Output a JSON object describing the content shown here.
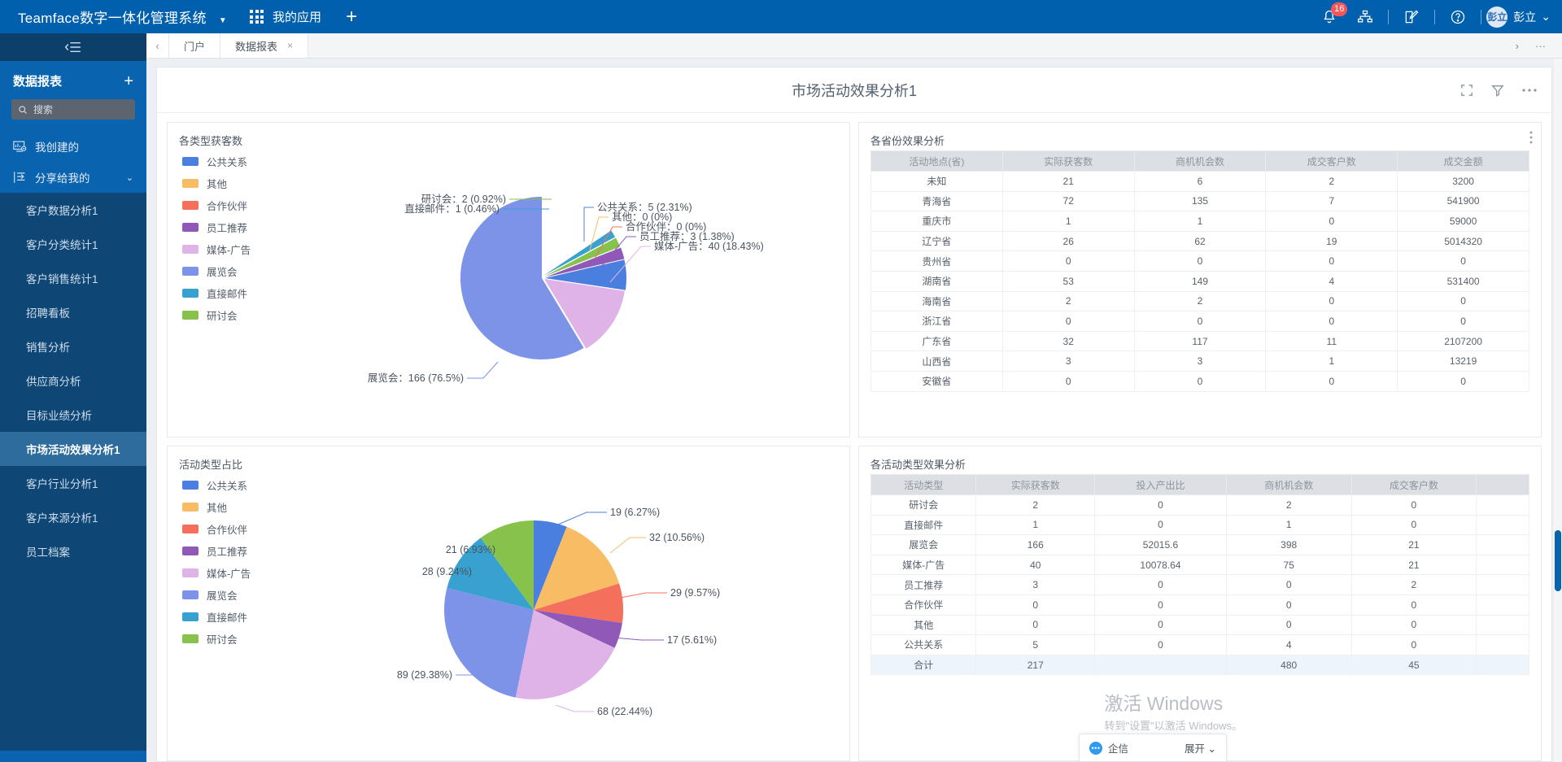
{
  "topbar": {
    "brand": "Teamface数字一体化管理系统",
    "caret": "▼",
    "myapps": "我的应用",
    "plus": "+",
    "notification_badge": "16",
    "icons": [
      "bell-icon",
      "org-chart-icon",
      "compose-icon",
      "help-icon"
    ],
    "avatar_text": "彭立",
    "username": "彭立",
    "user_caret": "⌄"
  },
  "sidebar": {
    "collapse_icon": "collapse-icon",
    "title": "数据报表",
    "add": "+",
    "search_placeholder": "搜索",
    "my_created": "我创建的",
    "shared_with_me": "分享给我的",
    "chevron": "⌄",
    "items": [
      {
        "label": "客户数据分析1",
        "active": false
      },
      {
        "label": "客户分类统计1",
        "active": false
      },
      {
        "label": "客户销售统计1",
        "active": false
      },
      {
        "label": "招聘看板",
        "active": false
      },
      {
        "label": "销售分析",
        "active": false
      },
      {
        "label": "供应商分析",
        "active": false
      },
      {
        "label": "目标业绩分析",
        "active": false
      },
      {
        "label": "市场活动效果分析1",
        "active": true
      },
      {
        "label": "客户行业分析1",
        "active": false
      },
      {
        "label": "客户来源分析1",
        "active": false
      },
      {
        "label": "员工档案",
        "active": false
      }
    ]
  },
  "tabbar": {
    "prev": "‹",
    "tabs": [
      {
        "label": "门户",
        "closable": false,
        "active": false
      },
      {
        "label": "数据报表",
        "closable": true,
        "active": true
      }
    ],
    "close_glyph": "×",
    "next": "›",
    "more": "···"
  },
  "page": {
    "title": "市场活动效果分析1",
    "tools": [
      "fullscreen-icon",
      "filter-icon",
      "more-icon"
    ]
  },
  "colors": {
    "public_relations": "#4a7fe0",
    "other": "#f8bd64",
    "partner": "#f4705c",
    "employee_referral": "#9059b8",
    "media_ad": "#e0b3e8",
    "exhibition": "#7c93e8",
    "direct_mail": "#39a1cf",
    "seminar": "#86c24c",
    "brand": "#0160ad",
    "sidebar": "#0e4675"
  },
  "chart_data": [
    {
      "type": "pie",
      "title": "各类型获客数",
      "legend_position": "left",
      "categories": [
        "公共关系",
        "其他",
        "合作伙伴",
        "员工推荐",
        "媒体-广告",
        "展览会",
        "直接邮件",
        "研讨会"
      ],
      "values": [
        5,
        0,
        0,
        3,
        40,
        166,
        1,
        2
      ],
      "percents": [
        "2.31%",
        "0%",
        "0%",
        "1.38%",
        "18.43%",
        "76.5%",
        "0.46%",
        "0.92%"
      ],
      "labels": [
        "公共关系：5 (2.31%)",
        "其他：0 (0%)",
        "合作伙伴：0 (0%)",
        "员工推荐：3 (1.38%)",
        "媒体-广告：40 (18.43%)",
        "展览会：166 (76.5%)",
        "直接邮件：1 (0.46%)",
        "研讨会：2 (0.92%)"
      ]
    },
    {
      "type": "pie",
      "title": "活动类型占比",
      "legend_position": "left",
      "categories": [
        "公共关系",
        "其他",
        "合作伙伴",
        "员工推荐",
        "媒体-广告",
        "展览会",
        "直接邮件",
        "研讨会"
      ],
      "values": [
        19,
        32,
        29,
        17,
        68,
        89,
        28,
        21
      ],
      "percents": [
        "6.27%",
        "10.56%",
        "9.57%",
        "5.61%",
        "22.44%",
        "29.38%",
        "9.24%",
        "6.93%"
      ],
      "labels": [
        "19 (6.27%)",
        "32 (10.56%)",
        "29 (9.57%)",
        "17 (5.61%)",
        "68 (22.44%)",
        "89 (29.38%)",
        "28 (9.24%)",
        "21 (6.93%)"
      ]
    }
  ],
  "province_table": {
    "title": "各省份效果分析",
    "menu": "⋮",
    "columns": [
      "活动地点(省)",
      "实际获客数",
      "商机机会数",
      "成交客户数",
      "成交金额"
    ],
    "rows": [
      [
        "未知",
        "21",
        "6",
        "2",
        "3200"
      ],
      [
        "青海省",
        "72",
        "135",
        "7",
        "541900"
      ],
      [
        "重庆市",
        "1",
        "1",
        "0",
        "59000"
      ],
      [
        "辽宁省",
        "26",
        "62",
        "19",
        "5014320"
      ],
      [
        "贵州省",
        "0",
        "0",
        "0",
        "0"
      ],
      [
        "湖南省",
        "53",
        "149",
        "4",
        "531400"
      ],
      [
        "海南省",
        "2",
        "2",
        "0",
        "0"
      ],
      [
        "浙江省",
        "0",
        "0",
        "0",
        "0"
      ],
      [
        "广东省",
        "32",
        "117",
        "11",
        "2107200"
      ],
      [
        "山西省",
        "3",
        "3",
        "1",
        "13219"
      ],
      [
        "安徽省",
        "0",
        "0",
        "0",
        "0"
      ]
    ]
  },
  "activity_table": {
    "title": "各活动类型效果分析",
    "columns": [
      "活动类型",
      "实际获客数",
      "投入产出比",
      "商机机会数",
      "成交客户数",
      ""
    ],
    "rows": [
      [
        "研讨会",
        "2",
        "0",
        "2",
        "0",
        ""
      ],
      [
        "直接邮件",
        "1",
        "0",
        "1",
        "0",
        ""
      ],
      [
        "展览会",
        "166",
        "52015.6",
        "398",
        "21",
        ""
      ],
      [
        "媒体-广告",
        "40",
        "10078.64",
        "75",
        "21",
        ""
      ],
      [
        "员工推荐",
        "3",
        "0",
        "0",
        "2",
        ""
      ],
      [
        "合作伙伴",
        "0",
        "0",
        "0",
        "0",
        ""
      ],
      [
        "其他",
        "0",
        "0",
        "0",
        "0",
        ""
      ],
      [
        "公共关系",
        "5",
        "0",
        "4",
        "0",
        ""
      ]
    ],
    "total_row": [
      "合计",
      "217",
      "",
      "480",
      "45",
      ""
    ]
  },
  "watermark": {
    "line1": "激活 Windows",
    "line2": "转到\"设置\"以激活 Windows。"
  },
  "chat": {
    "icon": "chat-icon",
    "label": "企信",
    "expand": "展开",
    "caret": "⌄"
  }
}
